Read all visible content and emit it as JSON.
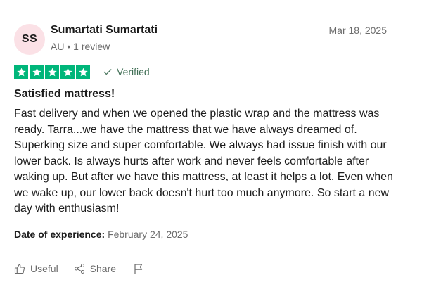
{
  "reviewer": {
    "initials": "SS",
    "name": "Sumartati Sumartati",
    "country": "AU",
    "review_count": "1 review",
    "separator": "•"
  },
  "review": {
    "date": "Mar 18, 2025",
    "rating": 5,
    "verified_label": "Verified",
    "title": "Satisfied mattress!",
    "body": "Fast delivery and when we opened the plastic wrap and the mattress was ready. Tarra...we have the mattress that we have always dreamed of. Superking size and super comfortable. We always had issue finish with our lower back. Is always hurts after work and never feels comfortable after waking up. But after we have this mattress, at least it helps a lot. Even when we wake up, our lower back doesn't hurt too much anymore. So start a new day with enthusiasm!",
    "experience_label": "Date of experience:",
    "experience_date": "February 24, 2025"
  },
  "actions": {
    "useful_label": "Useful",
    "share_label": "Share",
    "useful_icon": "thumbs-up-icon",
    "share_icon": "share-icon",
    "report_icon": "flag-icon"
  },
  "colors": {
    "star_green": "#00b67a",
    "avatar_bg": "#fbe1e6",
    "verified_text": "#3f6e54",
    "muted_text": "#6b6b6b"
  }
}
